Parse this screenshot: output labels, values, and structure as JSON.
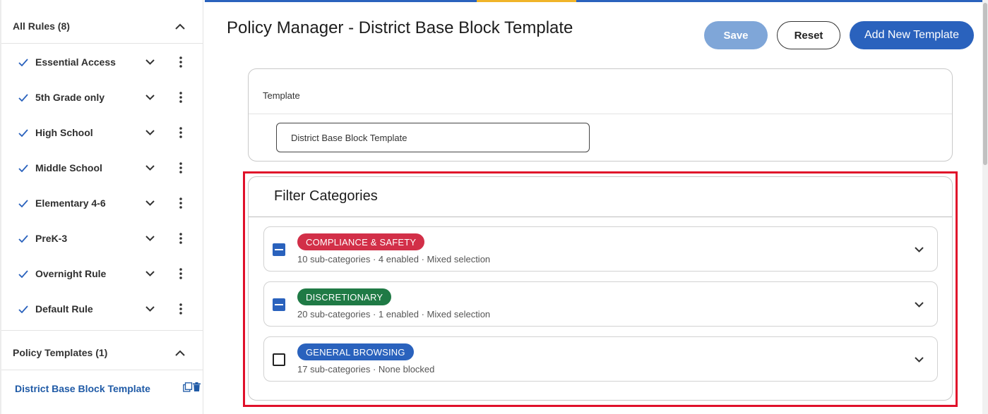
{
  "sidebar": {
    "rules_header": "All Rules (8)",
    "rules": [
      {
        "label": "Essential Access"
      },
      {
        "label": "5th Grade only"
      },
      {
        "label": "High School"
      },
      {
        "label": "Middle School"
      },
      {
        "label": "Elementary 4-6"
      },
      {
        "label": "PreK-3"
      },
      {
        "label": "Overnight Rule"
      },
      {
        "label": "Default Rule"
      }
    ],
    "templates_header": "Policy Templates (1)",
    "templates": [
      {
        "label": "District Base Block Template"
      }
    ]
  },
  "header": {
    "title": "Policy Manager - District Base Block Template",
    "save_label": "Save",
    "reset_label": "Reset",
    "add_label": "Add New Template"
  },
  "template_card": {
    "label": "Template",
    "value": "District Base Block Template"
  },
  "filter_categories": {
    "title": "Filter Categories",
    "items": [
      {
        "badge": "COMPLIANCE & SAFETY",
        "meta": "10 sub-categories · 4 enabled · Mixed selection",
        "state": "mixed",
        "color": "#d22f48"
      },
      {
        "badge": "DISCRETIONARY",
        "meta": "20 sub-categories · 1 enabled · Mixed selection",
        "state": "mixed",
        "color": "#1f7a45"
      },
      {
        "badge": "GENERAL BROWSING",
        "meta": "17 sub-categories · None blocked",
        "state": "unchecked",
        "color": "#2a62bd"
      }
    ]
  },
  "colors": {
    "primary": "#2a62bd",
    "primary_disabled": "#7fa6d8",
    "highlight": "#e0102a",
    "link": "#1f5aa6"
  }
}
